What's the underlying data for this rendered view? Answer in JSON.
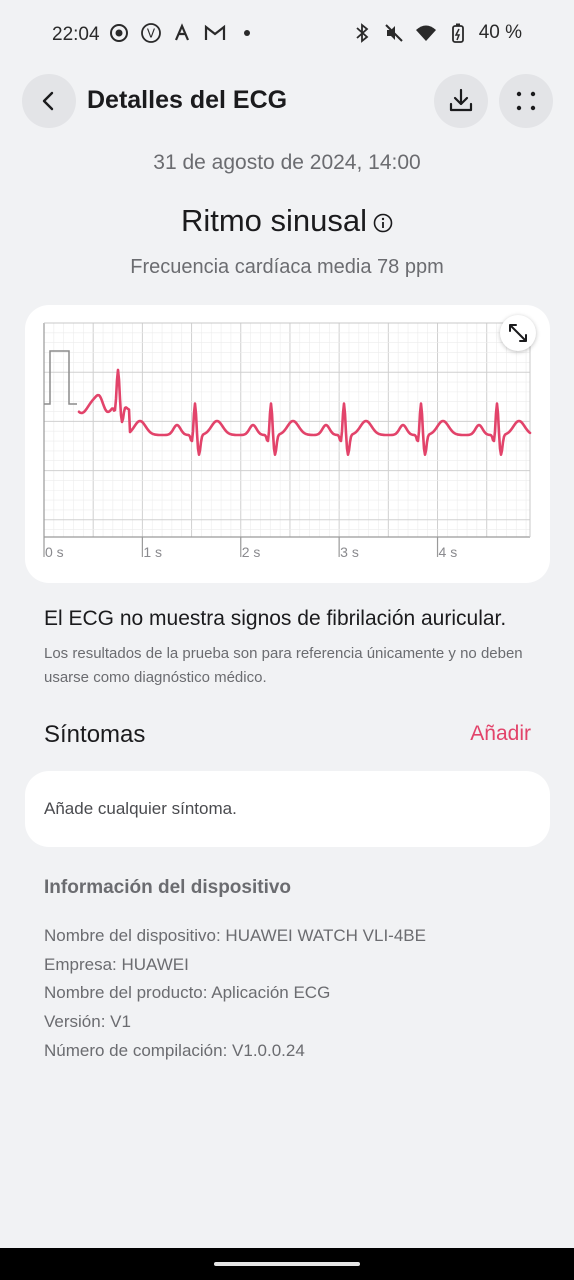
{
  "status_bar": {
    "time": "22:04",
    "left_icons": [
      "app-icon",
      "vpn-icon",
      "accessibility-icon",
      "gmail-icon",
      "dot-icon"
    ],
    "right_icons": [
      "bluetooth-icon",
      "mute-icon",
      "wifi-icon",
      "battery-icon"
    ],
    "battery": "40 %"
  },
  "header": {
    "title": "Detalles del ECG",
    "back_icon": "back-arrow-icon",
    "download_icon": "download-icon",
    "more_icon": "more-dots-icon"
  },
  "summary": {
    "date": "31 de agosto de 2024, 14:00",
    "result": "Ritmo sinusal",
    "heart_rate_label": "Frecuencia cardíaca media",
    "heart_rate_value": "78 ppm"
  },
  "ecg": {
    "time_labels": [
      "0 s",
      "1 s",
      "2 s",
      "3 s",
      "4 s"
    ],
    "trace_color": "#e2436a",
    "expand_icon": "expand-icon"
  },
  "assessment": {
    "headline": "El ECG no muestra signos de fibrilación auricular.",
    "disclaimer": "Los resultados de la prueba son para referencia únicamente y no deben usarse como diagnóstico médico."
  },
  "symptoms": {
    "title": "Síntomas",
    "add_label": "Añadir",
    "placeholder": "Añade cualquier síntoma."
  },
  "device": {
    "title": "Información del dispositivo",
    "lines": [
      "Nombre del dispositivo: HUAWEI WATCH VLI-4BE",
      "Empresa: HUAWEI",
      "Nombre del producto: Aplicación ECG",
      "Versión: V1",
      "Número de compilación: V1.0.0.24"
    ]
  },
  "colors": {
    "background": "#f1f2f4",
    "accent": "#e2436a",
    "card": "#ffffff"
  }
}
